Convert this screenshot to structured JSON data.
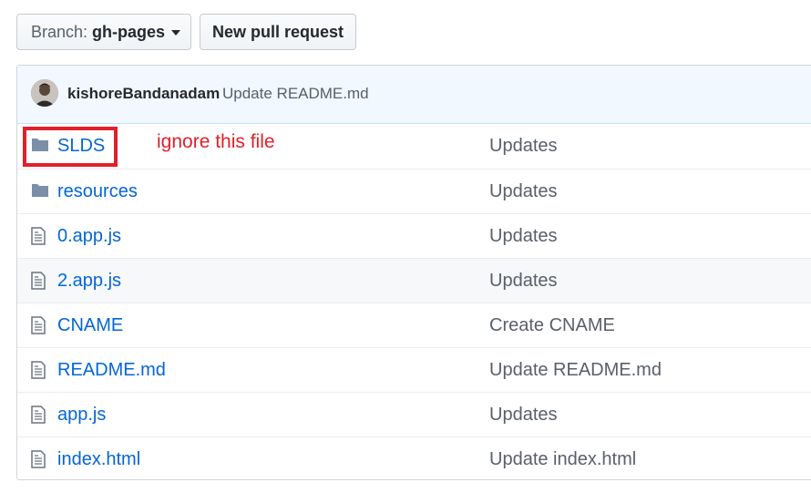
{
  "toolbar": {
    "branch_label": "Branch:",
    "branch_value": "gh-pages",
    "new_pr_label": "New pull request"
  },
  "commit": {
    "author": "kishoreBandanadam",
    "message": "Update README.md"
  },
  "files": [
    {
      "name": "SLDS",
      "type": "folder",
      "message": "Updates"
    },
    {
      "name": "resources",
      "type": "folder",
      "message": "Updates"
    },
    {
      "name": "0.app.js",
      "type": "file",
      "message": "Updates"
    },
    {
      "name": "2.app.js",
      "type": "file",
      "message": "Updates"
    },
    {
      "name": "CNAME",
      "type": "file",
      "message": "Create CNAME"
    },
    {
      "name": "README.md",
      "type": "file",
      "message": "Update README.md"
    },
    {
      "name": "app.js",
      "type": "file",
      "message": "Updates"
    },
    {
      "name": "index.html",
      "type": "file",
      "message": "Update index.html"
    }
  ],
  "annotation": {
    "text": "ignore this file",
    "color": "#e0202a"
  },
  "colors": {
    "link": "#0366d6",
    "commit_bar": "#f1f8ff",
    "icon": "#6a737d"
  }
}
